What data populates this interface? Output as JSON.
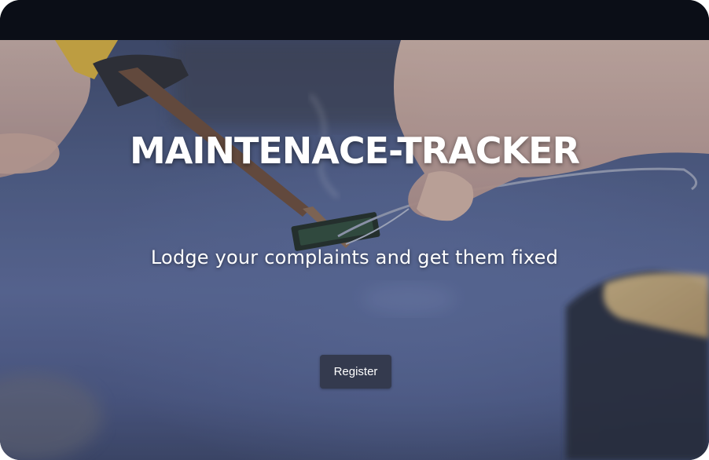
{
  "hero": {
    "title": "MAINTENACE-TRACKER",
    "subtitle": "Lodge your complaints and get them fixed",
    "register_label": "Register"
  },
  "colors": {
    "topbar": "#0b0e17",
    "button": "#343a4e",
    "text": "#ffffff"
  }
}
